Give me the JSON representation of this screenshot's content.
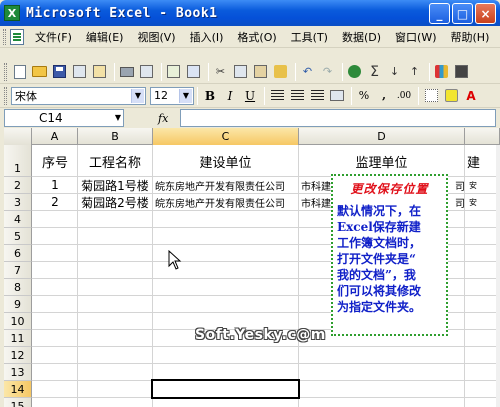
{
  "window": {
    "app_icon": "excel-icon",
    "title": "Microsoft Excel - Book1",
    "minimize": "_",
    "maximize": "□",
    "close": "×"
  },
  "menu": {
    "items": [
      "文件(F)",
      "编辑(E)",
      "视图(V)",
      "插入(I)",
      "格式(O)",
      "工具(T)",
      "数据(D)",
      "窗口(W)",
      "帮助(H)"
    ]
  },
  "toolbar": {
    "font_name": "宋体",
    "font_size": "12",
    "bold": "B",
    "italic": "I",
    "underline": "U",
    "percent": "%",
    "comma": ",",
    "decimals": ".00",
    "font_color_glyph": "A"
  },
  "formula_bar": {
    "name_box": "C14",
    "fx": "fx",
    "value": ""
  },
  "grid": {
    "columns": [
      "A",
      "B",
      "C",
      "D"
    ],
    "rows": [
      "1",
      "2",
      "3",
      "4",
      "5",
      "6",
      "7",
      "8",
      "9",
      "10",
      "11",
      "12",
      "13",
      "14",
      "15"
    ],
    "active_cell": "C14",
    "header_row": {
      "a": "序号",
      "b": "工程名称",
      "c": "建设单位",
      "d": "监理单位",
      "e": "建"
    },
    "row2": {
      "a": "1",
      "b": "菊园路1号楼",
      "c": "皖东房地产开发有限责任公司",
      "d": "市科建",
      "d_tail": "司",
      "e": "安"
    },
    "row3": {
      "a": "2",
      "b": "菊园路2号楼",
      "c": "皖东房地产开发有限责任公司",
      "d": "市科建",
      "d_tail": "司",
      "e": "安"
    }
  },
  "callout": {
    "title": "更改保存位置",
    "lines": [
      "默认情况下，在",
      "Excel保存新建",
      "工作簿文档时，",
      "打开文件夹是“",
      "我的文档”，我",
      "们可以将其修改",
      "为指定文件夹。"
    ]
  },
  "watermark": "Soft.Yesky.c@m",
  "colors": {
    "title_bar": "#0a5bdc",
    "callout_title": "#e0101a",
    "callout_body": "#1020c8",
    "callout_border": "#2e9e2e"
  }
}
